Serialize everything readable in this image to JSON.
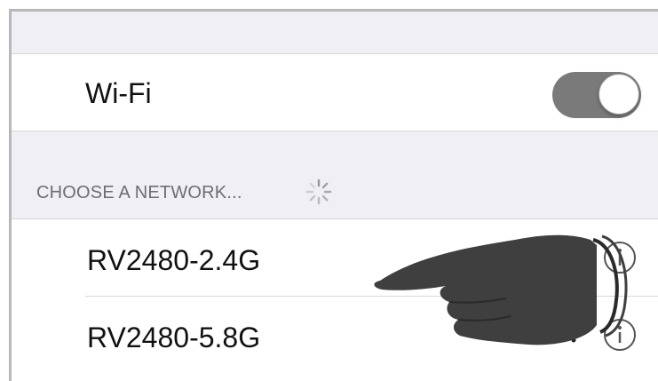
{
  "settings": {
    "wifi": {
      "label": "Wi-Fi",
      "enabled": true
    },
    "section_header": "CHOOSE A NETWORK...",
    "networks": [
      {
        "name": "RV2480-2.4G"
      },
      {
        "name": "RV2480-5.8G"
      }
    ]
  },
  "icons": {
    "toggle": "toggle-on",
    "spinner": "activity-spinner-icon",
    "info": "info-icon",
    "wifi_strength": "wifi-signal-icon",
    "pointer": "pointing-hand-icon"
  },
  "colors": {
    "toggle_on": "#7a7a7a",
    "background": "#efeff4",
    "hand": "#3f3f3f"
  }
}
